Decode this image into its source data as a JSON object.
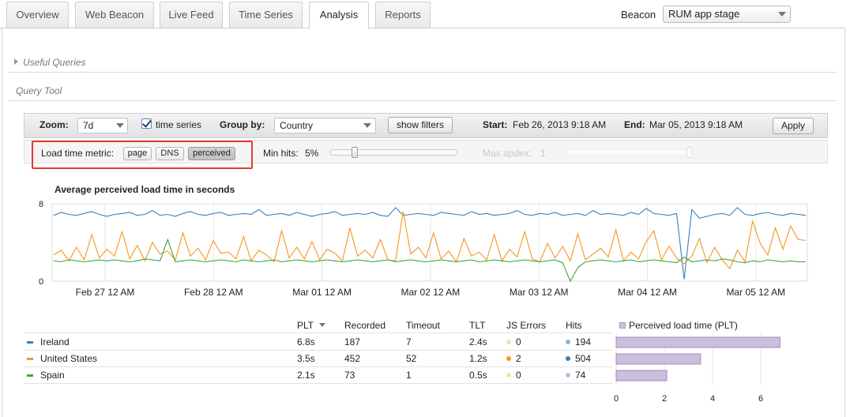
{
  "tabs": [
    "Overview",
    "Web Beacon",
    "Live Feed",
    "Time Series",
    "Analysis",
    "Reports"
  ],
  "active_tab": "Analysis",
  "beacon": {
    "label": "Beacon",
    "value": "RUM app stage"
  },
  "sections": {
    "useful_queries": "Useful Queries",
    "query_tool": "Query Tool"
  },
  "toolbar": {
    "zoom_label": "Zoom:",
    "zoom_value": "7d",
    "time_series_label": "time series",
    "time_series_checked": true,
    "group_by_label": "Group by:",
    "group_by_value": "Country",
    "show_filters": "show filters",
    "start_label": "Start:",
    "start_value": "Feb 26, 2013 9:18 AM",
    "end_label": "End:",
    "end_value": "Mar 05, 2013 9:18 AM",
    "apply": "Apply"
  },
  "metric_bar": {
    "load_time_label": "Load time metric:",
    "metrics": [
      "page",
      "DNS",
      "perceived"
    ],
    "active_metric": "perceived",
    "min_hits_label": "Min hits:",
    "min_hits_value": "5%",
    "min_hits_fraction": 0.18,
    "max_apdex_label": "Max apdex:",
    "max_apdex_value": "1"
  },
  "colors": {
    "ireland": "#3a7fc1",
    "united_states": "#f5961e",
    "spain": "#3aa83a",
    "highlight": "#e53a2d",
    "bar_fill": "#cbbfdb"
  },
  "chart_data": [
    {
      "type": "line",
      "title": "Average perceived load time in seconds",
      "ylim": [
        0,
        8
      ],
      "y_ticks": [
        "8",
        "0"
      ],
      "x_ticks": [
        "Feb 27 12 AM",
        "Feb 28 12 AM",
        "Mar 01 12 AM",
        "Mar 02 12 AM",
        "Mar 03 12 AM",
        "Mar 04 12 AM",
        "Mar 05 12 AM"
      ],
      "grid": true,
      "series": [
        {
          "name": "Ireland",
          "values": [
            6.8,
            7.1,
            6.9,
            6.8,
            7.0,
            7.2,
            6.9,
            6.7,
            6.9,
            7.0,
            7.1,
            6.8,
            6.9,
            7.3,
            6.8,
            6.9,
            6.7,
            7.0,
            7.2,
            6.9,
            6.8,
            7.0,
            7.1,
            6.8,
            6.9,
            7.0,
            6.9,
            7.4,
            6.8,
            6.9,
            7.0,
            6.8,
            7.1,
            6.9,
            6.7,
            6.9,
            7.0,
            7.2,
            6.8,
            6.9,
            7.0,
            6.9,
            7.1,
            6.8,
            6.7,
            7.6,
            6.8,
            6.9,
            7.0,
            6.9,
            6.8,
            7.1,
            7.0,
            6.9,
            6.8,
            7.2,
            6.9,
            7.0,
            6.8,
            6.9,
            7.0,
            7.3,
            6.9,
            6.8,
            7.0,
            6.9,
            7.1,
            6.8,
            6.9,
            7.0,
            6.8,
            7.3,
            6.9,
            7.0,
            6.9,
            6.8,
            7.1,
            6.9,
            7.5,
            7.0,
            6.9,
            6.8,
            7.0,
            0.2,
            7.4,
            6.5,
            6.7,
            6.9,
            7.0,
            6.8,
            7.6,
            6.9,
            6.8,
            7.0,
            7.1,
            6.9,
            6.8,
            7.0,
            6.9,
            6.8
          ]
        },
        {
          "name": "United States",
          "values": [
            2.7,
            3.2,
            2.1,
            3.5,
            2.2,
            4.8,
            2.4,
            3.3,
            2.6,
            5.1,
            2.3,
            3.7,
            2.1,
            4.0,
            2.8,
            3.1,
            2.2,
            5.0,
            2.6,
            3.4,
            2.2,
            4.2,
            2.9,
            3.0,
            2.3,
            4.6,
            2.1,
            3.2,
            2.7,
            2.0,
            5.2,
            2.4,
            3.5,
            2.3,
            4.1,
            2.2,
            3.3,
            2.9,
            2.1,
            5.5,
            2.6,
            3.2,
            2.4,
            4.3,
            2.2,
            2.1,
            7.2,
            2.8,
            3.5,
            2.4,
            5.0,
            2.3,
            3.1,
            2.0,
            4.4,
            2.6,
            3.0,
            2.2,
            4.8,
            2.1,
            3.3,
            2.5,
            5.1,
            2.3,
            2.0,
            3.9,
            2.4,
            3.6,
            2.1,
            4.9,
            2.2,
            2.8,
            3.4,
            2.5,
            5.3,
            2.1,
            3.0,
            2.3,
            4.1,
            5.2,
            2.2,
            3.6,
            2.4,
            1.8,
            2.6,
            4.4,
            1.9,
            3.5,
            2.2,
            1.3,
            3.2,
            2.0,
            6.2,
            3.9,
            2.7,
            5.5,
            3.3,
            5.7,
            4.3,
            4.2
          ]
        },
        {
          "name": "Spain",
          "values": [
            2.1,
            2.0,
            2.2,
            2.1,
            2.0,
            2.1,
            2.2,
            2.1,
            2.2,
            2.1,
            2.0,
            2.1,
            2.3,
            2.2,
            2.1,
            4.3,
            2.0,
            2.1,
            2.2,
            2.1,
            2.0,
            2.1,
            2.2,
            2.1,
            2.0,
            2.2,
            2.1,
            2.0,
            2.1,
            2.2,
            2.0,
            2.1,
            2.2,
            2.1,
            2.0,
            2.1,
            2.2,
            2.1,
            2.0,
            2.1,
            2.2,
            2.1,
            2.0,
            2.1,
            2.2,
            2.0,
            2.1,
            2.2,
            2.1,
            2.0,
            2.1,
            2.2,
            2.1,
            2.0,
            2.1,
            2.2,
            2.0,
            2.1,
            2.2,
            2.1,
            2.0,
            2.1,
            2.2,
            2.1,
            2.0,
            2.1,
            2.2,
            1.9,
            0.0,
            1.4,
            2.0,
            2.1,
            2.2,
            2.1,
            2.0,
            2.1,
            2.2,
            2.0,
            2.1,
            2.2,
            2.1,
            2.0,
            1.9,
            2.5,
            2.0,
            2.1,
            2.2,
            2.1,
            2.3,
            2.2,
            2.0,
            1.9,
            2.1,
            2.0,
            2.2,
            2.1,
            2.0,
            2.1,
            2.0,
            2.0
          ]
        }
      ]
    },
    {
      "type": "bar",
      "title": "Perceived load time (PLT)",
      "categories": [
        "Ireland",
        "United States",
        "Spain"
      ],
      "values": [
        6.8,
        3.5,
        2.1
      ],
      "x_ticks": [
        "0",
        "2",
        "4",
        "6"
      ],
      "xlim": [
        0,
        8
      ]
    }
  ],
  "table": {
    "headers": [
      "PLT",
      "Recorded",
      "Timeout",
      "TLT",
      "JS Errors",
      "Hits"
    ],
    "rows": [
      {
        "country": "Ireland",
        "plt": "6.8s",
        "recorded": "187",
        "timeout": "7",
        "tlt": "2.4s",
        "js_errors": "0",
        "hits": "194"
      },
      {
        "country": "United States",
        "plt": "3.5s",
        "recorded": "452",
        "timeout": "52",
        "tlt": "1.2s",
        "js_errors": "2",
        "hits": "504"
      },
      {
        "country": "Spain",
        "plt": "2.1s",
        "recorded": "73",
        "timeout": "1",
        "tlt": "0.5s",
        "js_errors": "0",
        "hits": "74"
      }
    ]
  }
}
